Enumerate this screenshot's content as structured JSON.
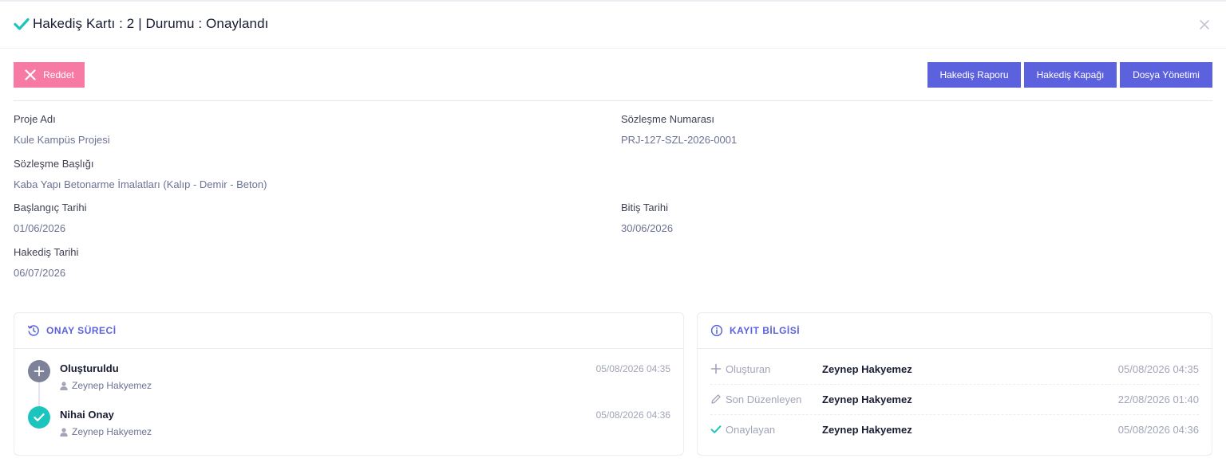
{
  "header": {
    "title": "Hakediş Kartı : 2 | Durumu : Onaylandı",
    "status_icon": "check-icon",
    "close_icon": "close-icon"
  },
  "toolbar": {
    "reject_label": "Reddet",
    "report_label": "Hakediş Raporu",
    "cover_label": "Hakediş Kapağı",
    "files_label": "Dosya Yönetimi"
  },
  "fields": {
    "project_name_label": "Proje Adı",
    "project_name": "Kule Kampüs Projesi",
    "contract_no_label": "Sözleşme Numarası",
    "contract_no": "PRJ-127-SZL-2026-0001",
    "contract_title_label": "Sözleşme Başlığı",
    "contract_title": "Kaba Yapı Betonarme İmalatları (Kalıp - Demir - Beton)",
    "start_date_label": "Başlangıç Tarihi",
    "start_date": "01/06/2026",
    "end_date_label": "Bitiş Tarihi",
    "end_date": "30/06/2026",
    "progress_date_label": "Hakediş Tarihi",
    "progress_date": "06/07/2026"
  },
  "approval": {
    "title": "ONAY SÜRECİ",
    "steps": [
      {
        "title": "Oluşturuldu",
        "user": "Zeynep Hakyemez",
        "date": "05/08/2026 04:35",
        "icon": "plus-icon"
      },
      {
        "title": "Nihai Onay",
        "user": "Zeynep Hakyemez",
        "date": "05/08/2026 04:36",
        "icon": "check-icon"
      }
    ]
  },
  "record": {
    "title": "KAYIT BİLGİSİ",
    "rows": [
      {
        "label": "Oluşturan",
        "user": "Zeynep Hakyemez",
        "date": "05/08/2026 04:35",
        "icon": "plus-icon"
      },
      {
        "label": "Son Düzenleyen",
        "user": "Zeynep Hakyemez",
        "date": "22/08/2026 01:40",
        "icon": "pencil-icon"
      },
      {
        "label": "Onaylayan",
        "user": "Zeynep Hakyemez",
        "date": "05/08/2026 04:36",
        "icon": "check-icon"
      }
    ]
  },
  "colors": {
    "primary": "#5c62de",
    "reject": "#f77aa5",
    "success": "#1bc5bd",
    "muted": "#7e8299"
  }
}
